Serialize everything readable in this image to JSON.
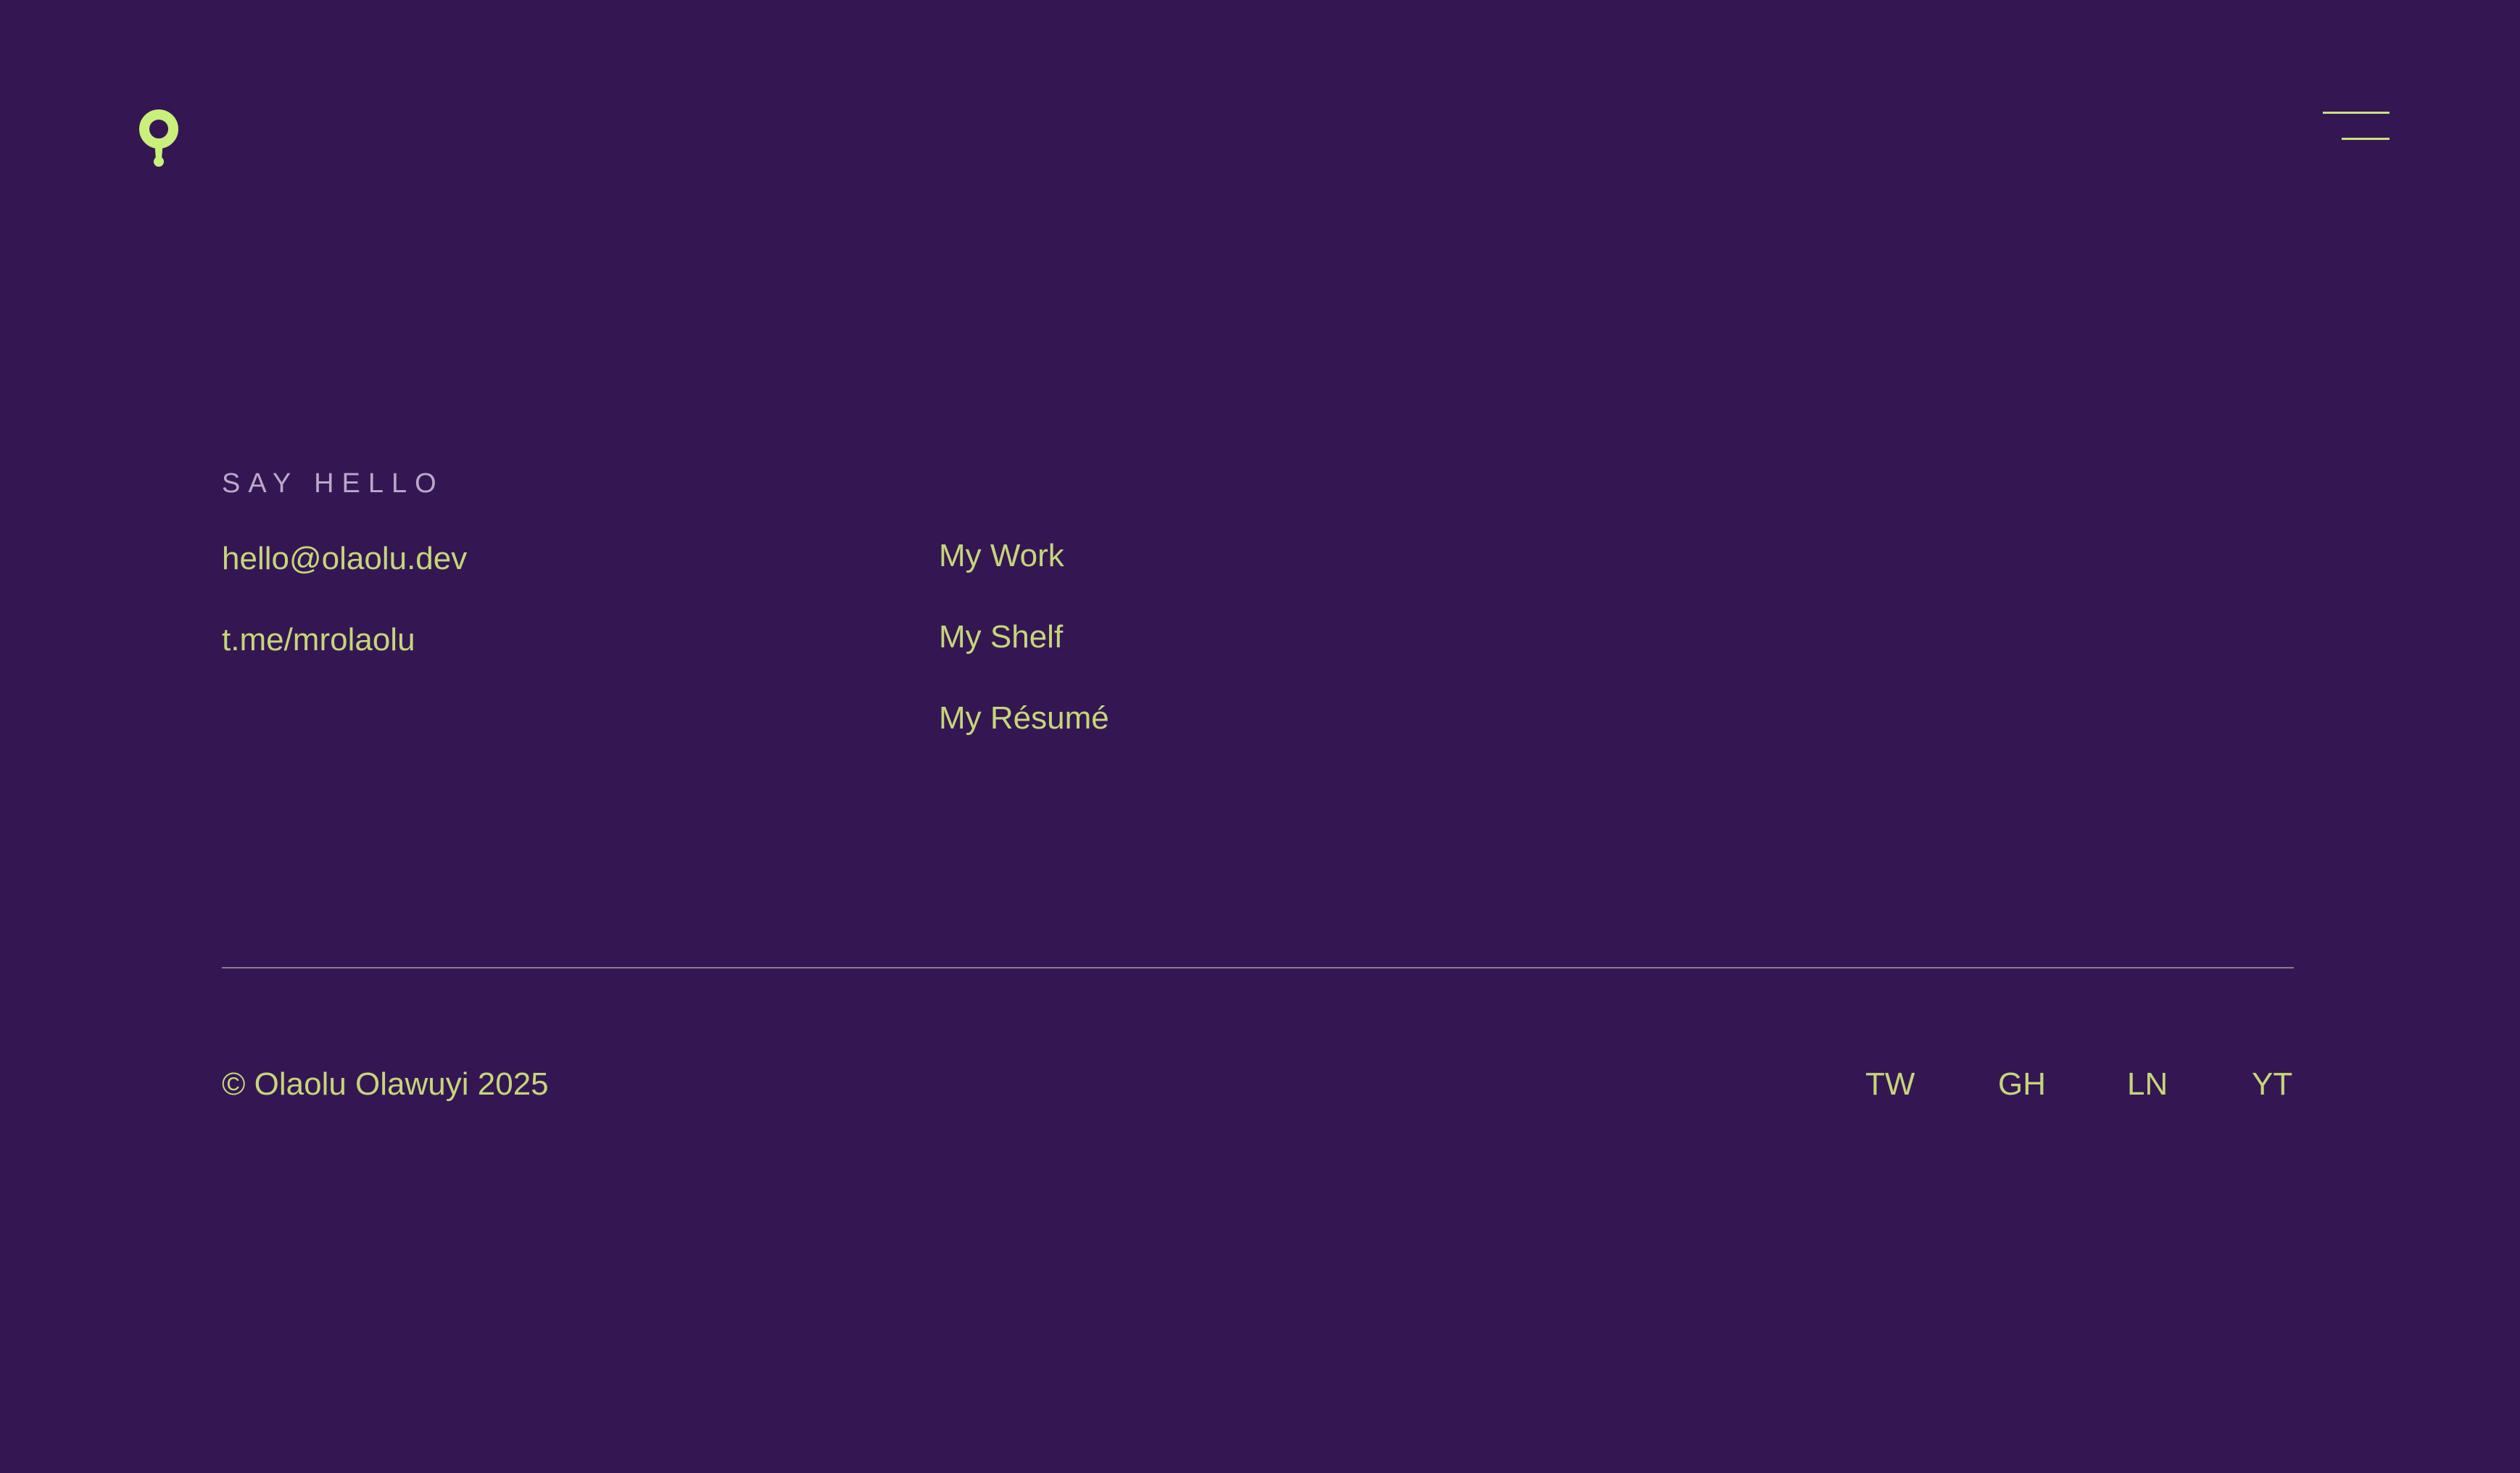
{
  "header": {
    "logo_icon": "pin-drop-logo-icon",
    "menu_icon": "hamburger-menu-icon"
  },
  "contact": {
    "heading": "SAY HELLO",
    "email": "hello@olaolu.dev",
    "telegram": "t.me/mrolaolu"
  },
  "nav": {
    "items": [
      {
        "label": "My Work"
      },
      {
        "label": "My Shelf"
      },
      {
        "label": "My Résumé"
      }
    ]
  },
  "footer": {
    "copyright": "© Olaolu Olawuyi 2025",
    "social": [
      {
        "label": "TW"
      },
      {
        "label": "GH"
      },
      {
        "label": "LN"
      },
      {
        "label": "YT"
      }
    ]
  },
  "colors": {
    "background": "#341752",
    "accent": "#c5d67a",
    "logo": "#c9f07a",
    "muted_text": "#b9a9c9",
    "divider": "#8b7e8c"
  }
}
